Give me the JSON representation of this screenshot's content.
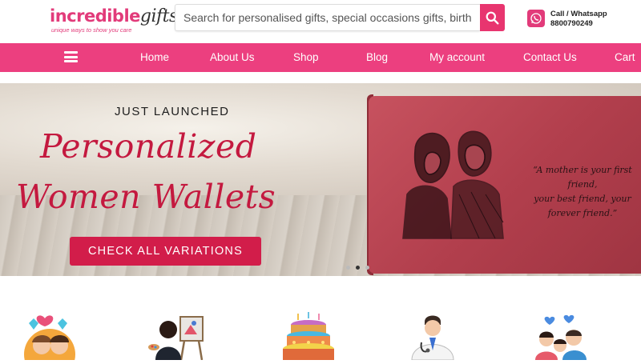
{
  "header": {
    "logo_main": "incredible",
    "logo_gifts": "gifts",
    "logo_tagline": "unique ways to show you care",
    "search_placeholder": "Search for personalised gifts, special occasions gifts, birthday gifts a",
    "contact_label": "Call / Whatsapp",
    "contact_number": "8800790249"
  },
  "nav": {
    "items": [
      {
        "label": "Home"
      },
      {
        "label": "About Us"
      },
      {
        "label": "Shop"
      },
      {
        "label": "Blog"
      },
      {
        "label": "My account"
      },
      {
        "label": "Contact Us"
      },
      {
        "label": "Cart"
      }
    ]
  },
  "banner": {
    "eyebrow": "JUST LAUNCHED",
    "title_line1": "Personalized",
    "title_line2": "Women Wallets",
    "cta_label": "CHECK ALL VARIATIONS",
    "quote_line1": "“A mother is your first friend,",
    "quote_line2": "your best friend, your",
    "quote_line3": "forever friend.”"
  },
  "colors": {
    "brand_pink": "#ec3f7f",
    "cta_red": "#d21d4a",
    "title_red": "#c4193f"
  },
  "categories": [
    {
      "icon": "wedding-couple-icon"
    },
    {
      "icon": "painter-icon"
    },
    {
      "icon": "birthday-cake-icon"
    },
    {
      "icon": "doctor-icon"
    },
    {
      "icon": "family-icon"
    }
  ]
}
